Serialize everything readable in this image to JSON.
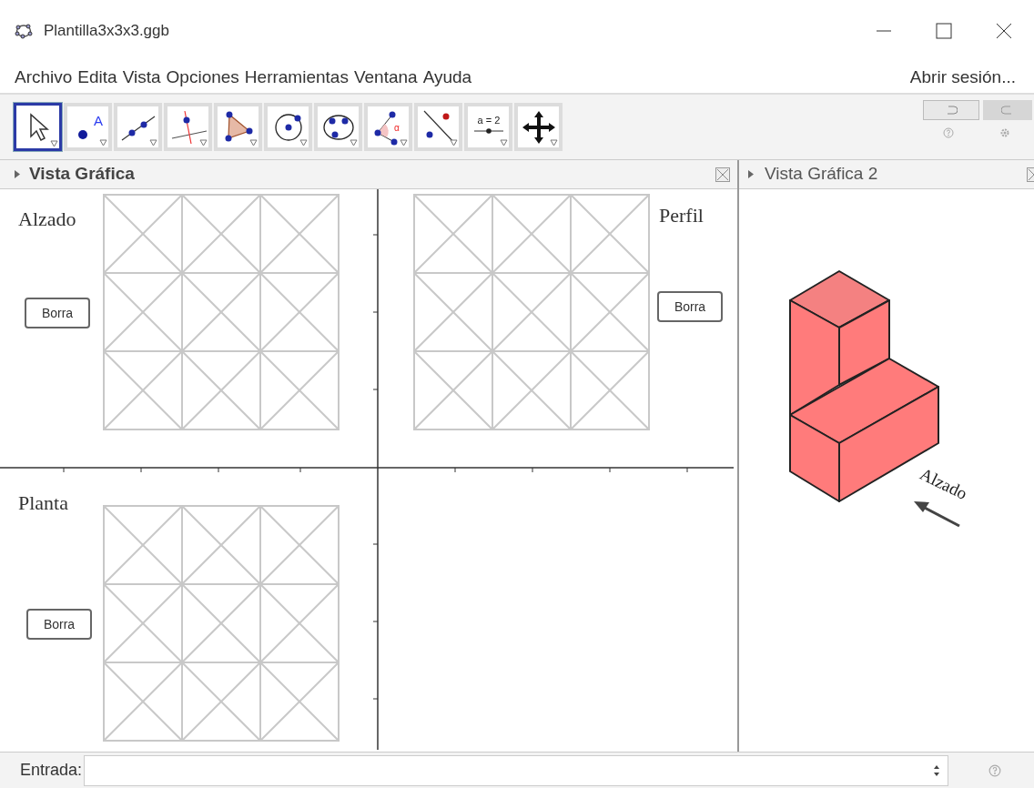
{
  "window": {
    "title": "Plantilla3x3x3.ggb"
  },
  "menu": {
    "items": [
      "Archivo",
      "Edita",
      "Vista",
      "Opciones",
      "Herramientas",
      "Ventana",
      "Ayuda"
    ],
    "sign_in": "Abrir sesión..."
  },
  "toolbar": {
    "tools": [
      {
        "kind": "move",
        "selected": true
      },
      {
        "kind": "point",
        "glyph": "A",
        "selected": false
      },
      {
        "kind": "line",
        "selected": false
      },
      {
        "kind": "perpendicular",
        "selected": false
      },
      {
        "kind": "polygon",
        "selected": false
      },
      {
        "kind": "circle",
        "selected": false
      },
      {
        "kind": "conic",
        "selected": false
      },
      {
        "kind": "angle",
        "glyph": "α",
        "selected": false
      },
      {
        "kind": "reflect",
        "selected": false
      },
      {
        "kind": "slider",
        "glyph": "a = 2",
        "selected": false
      },
      {
        "kind": "move-view",
        "selected": false
      }
    ]
  },
  "graphics_view": {
    "title": "Vista Gráfica",
    "grids": [
      {
        "label": "Alzado",
        "button": "Borra"
      },
      {
        "label": "Perfil",
        "button": "Borra"
      },
      {
        "label": "Planta",
        "button": "Borra"
      }
    ]
  },
  "graphics_view_2": {
    "title": "Vista Gráfica 2",
    "direction_label": "Alzado"
  },
  "input_bar": {
    "label": "Entrada:"
  }
}
